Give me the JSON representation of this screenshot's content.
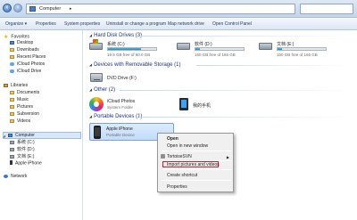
{
  "address": {
    "crumb": "Computer",
    "separator": "▸"
  },
  "toolbar": {
    "organize": "Organize ▾",
    "properties": "Properties",
    "system_properties": "System properties",
    "uninstall": "Uninstall or change a program",
    "map_drive": "Map network drive",
    "control_panel": "Open Control Panel"
  },
  "nav": {
    "favorites": "Favorites",
    "desktop": "Desktop",
    "downloads": "Downloads",
    "recent_places": "Recent Places",
    "icloud_photos": "iCloud Photos",
    "icloud_drive": "iCloud Drive",
    "libraries": "Libraries",
    "documents": "Documents",
    "music": "Music",
    "pictures": "Pictures",
    "subversion": "Subversion",
    "videos": "Videos",
    "computer": "Computer",
    "drive_c": "系统 (C:)",
    "drive_d": "软件 (D:)",
    "drive_e": "文档 (E:)",
    "iphone": "Apple iPhone",
    "network": "Network"
  },
  "groups": {
    "hdd": "Hard Disk Drives (3)",
    "removable": "Devices with Removable Storage (1)",
    "other": "Other (2)",
    "portable": "Portable Devices (1)"
  },
  "drives": [
    {
      "name": "系统 (C:)",
      "size": "19.5 GB free of 60.0 GB",
      "used_fraction": 0.68
    },
    {
      "name": "软件 (D:)",
      "size": "150 GB free of 165 GB",
      "used_fraction": 0.09
    },
    {
      "name": "文档 (E:)",
      "size": "150 GB free of 165 GB",
      "used_fraction": 0.09
    }
  ],
  "removable": {
    "dvd": "DVD Drive (F:)"
  },
  "other": {
    "icloud_name": "iCloud Photos",
    "icloud_sub": "System Folder",
    "myphone": "我的手机"
  },
  "device": {
    "name": "Apple iPhone",
    "sub": "Portable Device"
  },
  "context_menu": {
    "open": "Open",
    "open_new_window": "Open in new window",
    "tortoise": "TortoiseSVN",
    "import": "Import pictures and videos",
    "shortcut": "Create shortcut",
    "properties": "Properties"
  },
  "colors": {
    "highlight_box": "#e0171f",
    "group_header": "#1e3287",
    "drive_fill": "#26a0da"
  }
}
